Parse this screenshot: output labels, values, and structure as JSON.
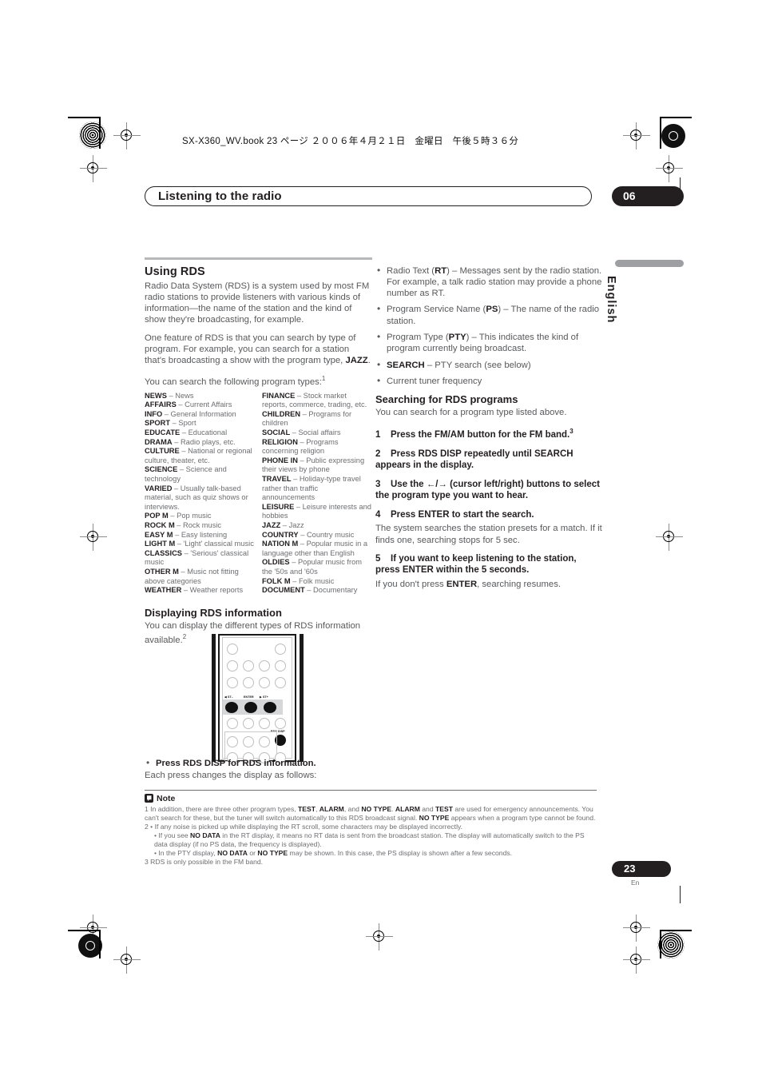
{
  "print": {
    "book_line": "SX-X360_WV.book 23 ページ ２００６年４月２１日　金曜日　午後５時３６分"
  },
  "header": {
    "title": "Listening to the radio",
    "chapter": "06"
  },
  "language_tab": {
    "label": "English"
  },
  "left_column": {
    "section_title": "Using RDS",
    "intro1": "Radio Data System (RDS) is a system used by most FM radio stations to provide listeners with various kinds of information—the name of the station and the kind of show they're broadcasting, for example.",
    "intro2_a": "One feature of RDS is that you can search by type of program. For example, you can search for a station that's broadcasting a show with the program type, ",
    "intro2_bold": "JAZZ",
    "intro2_b": ".",
    "list_lead": "You can search the following program types:",
    "list_lead_sup": "1",
    "program_types_left": [
      {
        "code": "NEWS",
        "desc": "News"
      },
      {
        "code": "AFFAIRS",
        "desc": "Current Affairs"
      },
      {
        "code": "INFO",
        "desc": "General Information"
      },
      {
        "code": "SPORT",
        "desc": "Sport"
      },
      {
        "code": "EDUCATE",
        "desc": "Educational"
      },
      {
        "code": "DRAMA",
        "desc": "Radio plays, etc."
      },
      {
        "code": "CULTURE",
        "desc": "National or regional culture, theater, etc."
      },
      {
        "code": "SCIENCE",
        "desc": "Science and technology"
      },
      {
        "code": "VARIED",
        "desc": "Usually talk-based material, such as quiz shows or interviews."
      },
      {
        "code": "POP M",
        "desc": "Pop music"
      },
      {
        "code": "ROCK M",
        "desc": "Rock music"
      },
      {
        "code": "EASY M",
        "desc": "Easy listening"
      },
      {
        "code": "LIGHT M",
        "desc": "'Light' classical music"
      },
      {
        "code": "CLASSICS",
        "desc": "'Serious' classical music"
      },
      {
        "code": "OTHER M",
        "desc": "Music not fitting above categories"
      },
      {
        "code": "WEATHER",
        "desc": "Weather reports"
      }
    ],
    "program_types_right": [
      {
        "code": "FINANCE",
        "desc": "Stock market reports, commerce, trading, etc."
      },
      {
        "code": "CHILDREN",
        "desc": "Programs for children"
      },
      {
        "code": "SOCIAL",
        "desc": "Social affairs"
      },
      {
        "code": "RELIGION",
        "desc": "Programs concerning religion"
      },
      {
        "code": "PHONE IN",
        "desc": "Public expressing their views by phone"
      },
      {
        "code": "TRAVEL",
        "desc": "Holiday-type travel rather than traffic announcements"
      },
      {
        "code": "LEISURE",
        "desc": "Leisure interests and hobbies"
      },
      {
        "code": "JAZZ",
        "desc": "Jazz"
      },
      {
        "code": "COUNTRY",
        "desc": "Country music"
      },
      {
        "code": "NATION M",
        "desc": "Popular music in a language other than English"
      },
      {
        "code": "OLDIES",
        "desc": "Popular music from the '50s and '60s"
      },
      {
        "code": "FOLK M",
        "desc": "Folk music"
      },
      {
        "code": "DOCUMENT",
        "desc": "Documentary"
      }
    ],
    "display_heading": "Displaying RDS information",
    "display_body": "You can display the different types of RDS information available.",
    "display_body_sup": "2",
    "remote": {
      "label_left": "ST–",
      "label_center": "ENTER",
      "label_right": "ST+",
      "label_rds": "RDS DISP"
    },
    "press_bullet": "Press RDS DISP for RDS information.",
    "press_body": "Each press changes the display as follows:"
  },
  "right_column": {
    "bullets": [
      {
        "pre": "Radio Text (",
        "bold": "RT",
        "post": ") – Messages sent by the radio station. For example, a talk radio station may provide a phone number as RT."
      },
      {
        "pre": "Program Service Name (",
        "bold": "PS",
        "post": ") – The name of the radio station."
      },
      {
        "pre": "Program Type (",
        "bold": "PTY",
        "post": ") – This indicates the kind of program currently being broadcast."
      },
      {
        "pre": "",
        "bold": "SEARCH",
        "post": " – PTY search (see below)"
      },
      {
        "pre": "Current tuner frequency",
        "bold": "",
        "post": ""
      }
    ],
    "search_heading": "Searching for RDS programs",
    "search_intro": "You can search for a program type listed above.",
    "steps": [
      {
        "n": "1",
        "text": "Press the FM/AM button for the FM band.",
        "sup": "3",
        "body": ""
      },
      {
        "n": "2",
        "text": "Press RDS DISP repeatedly until SEARCH appears in the display.",
        "sup": "",
        "body": ""
      },
      {
        "n": "3",
        "text": "Use the ←/→ (cursor left/right) buttons to select the program type you want to hear.",
        "sup": "",
        "body": ""
      },
      {
        "n": "4",
        "text": "Press ENTER to start the search.",
        "sup": "",
        "body": "The system searches the station presets for a match. If it finds one, searching stops for 5 sec."
      },
      {
        "n": "5",
        "text": "If you want to keep listening to the station, press ENTER within the 5 seconds.",
        "sup": "",
        "body_pre": "If you don't press ",
        "body_bold": "ENTER",
        "body_post": ", searching resumes."
      }
    ]
  },
  "note": {
    "heading": "Note",
    "fn1_a": "1 In addition, there are three other program types, ",
    "fn1_b1": "TEST",
    "fn1_b": ", ",
    "fn1_b2": "ALARM",
    "fn1_c": ", and ",
    "fn1_b3": "NO TYPE",
    "fn1_d": ". ",
    "fn1_b4": "ALARM",
    "fn1_e": " and ",
    "fn1_b5": "TEST",
    "fn1_f": " are used for emergency announcements. You can't search for these, but the tuner will switch automatically to this RDS broadcast signal. ",
    "fn1_b6": "NO TYPE",
    "fn1_g": " appears when a program type cannot be found.",
    "fn2": "2 • If any noise is picked up while displaying the RT scroll, some characters may be displayed incorrectly.",
    "fn2b_a": "• If you see ",
    "fn2b_b": "NO DATA",
    "fn2b_c": " in the RT display, it means no RT data is sent from the broadcast station. The display will automatically switch to the PS data display (if no PS data, the frequency is displayed).",
    "fn2c_a": "• In the PTY display, ",
    "fn2c_b": "NO DATA",
    "fn2c_c": " or ",
    "fn2c_d": "NO TYPE",
    "fn2c_e": " may be shown. In this case, the PS display is shown after a few seconds.",
    "fn3": "3 RDS is only possible in the FM band."
  },
  "footer": {
    "page_number": "23",
    "page_lang": "En"
  }
}
